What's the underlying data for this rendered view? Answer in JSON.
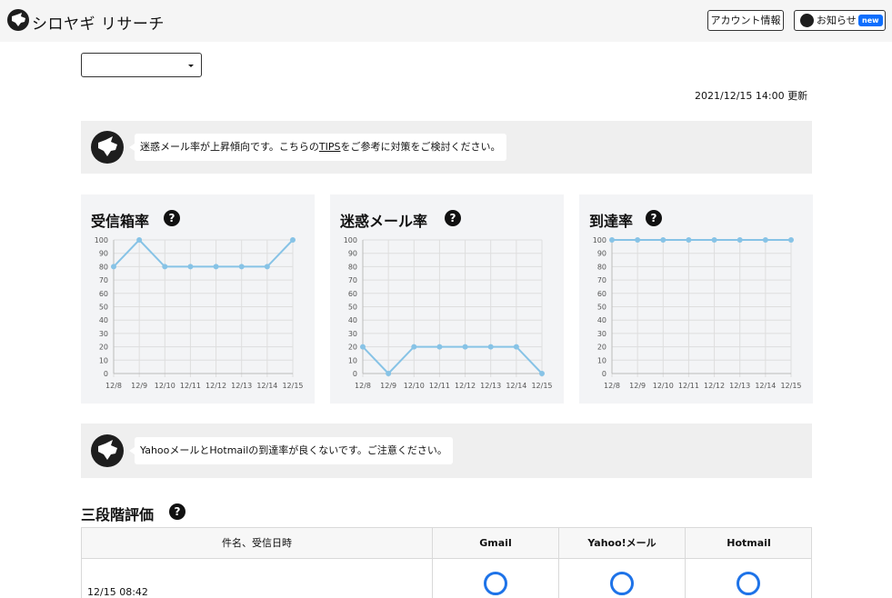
{
  "header": {
    "brand": "シロヤギ リサーチ",
    "account_button": "アカウント情報",
    "notice_button": "お知らせ",
    "notice_badge": "new"
  },
  "select": {
    "value": ""
  },
  "updated": "2021/12/15 14:00 更新",
  "notices": [
    {
      "text_before": "迷惑メール率が上昇傾向です。こちらの",
      "link": "TIPS",
      "text_after": "をご参考に対策をご検討ください。"
    },
    {
      "text": "YahooメールとHotmailの到達率が良くないです。ご注意ください。"
    }
  ],
  "help_icon": "question-circle-icon",
  "colors": {
    "line": "#87c3e6",
    "badge": "#0d6efd",
    "circle": "#1e73e8"
  },
  "chart_data": [
    {
      "type": "line",
      "title": "受信箱率",
      "categories": [
        "12/8",
        "12/9",
        "12/10",
        "12/11",
        "12/12",
        "12/13",
        "12/14",
        "12/15"
      ],
      "values": [
        80,
        100,
        80,
        80,
        80,
        80,
        80,
        100
      ],
      "yticks": [
        "0",
        "10",
        "20",
        "30",
        "40",
        "50",
        "60",
        "70",
        "80",
        "90",
        "100"
      ],
      "ylim": [
        0,
        100
      ],
      "grid": true
    },
    {
      "type": "line",
      "title": "迷惑メール率",
      "categories": [
        "12/8",
        "12/9",
        "12/10",
        "12/11",
        "12/12",
        "12/13",
        "12/14",
        "12/15"
      ],
      "values": [
        20,
        0,
        20,
        20,
        20,
        20,
        20,
        0
      ],
      "yticks": [
        "0",
        "10",
        "20",
        "30",
        "40",
        "50",
        "60",
        "70",
        "80",
        "90",
        "100"
      ],
      "ylim": [
        0,
        100
      ],
      "grid": true
    },
    {
      "type": "line",
      "title": "到達率",
      "categories": [
        "12/8",
        "12/9",
        "12/10",
        "12/11",
        "12/12",
        "12/13",
        "12/14",
        "12/15"
      ],
      "values": [
        100,
        100,
        100,
        100,
        100,
        100,
        100,
        100
      ],
      "yticks": [
        "0",
        "10",
        "20",
        "30",
        "40",
        "50",
        "60",
        "70",
        "80",
        "90",
        "100"
      ],
      "ylim": [
        0,
        100
      ],
      "grid": true
    }
  ],
  "evaluation": {
    "title": "三段階評価",
    "columns": [
      "件名、受信日時",
      "Gmail",
      "Yahoo!メール",
      "Hotmail"
    ],
    "rows": [
      {
        "date": "12/15 08:42",
        "gmail": "good-circle",
        "yahoo": "good-circle",
        "hotmail": "good-circle"
      }
    ]
  }
}
